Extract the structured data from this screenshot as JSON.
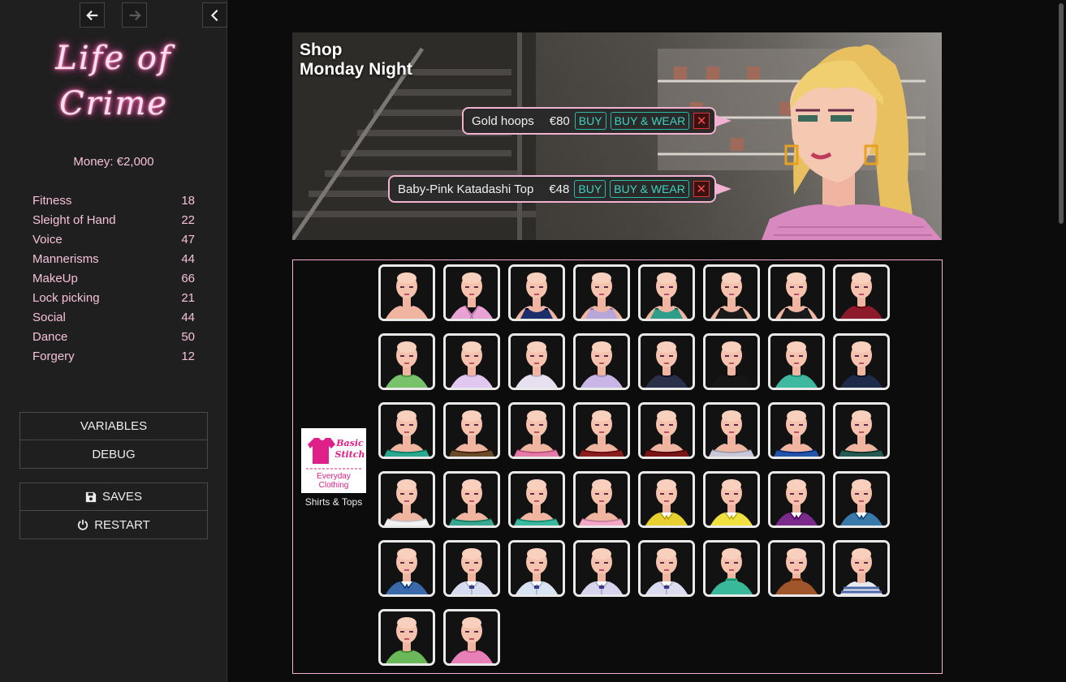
{
  "sidebar": {
    "logo": "Life of Crime",
    "money": "Money: €2,000",
    "skills": [
      {
        "name": "Fitness",
        "value": "18"
      },
      {
        "name": "Sleight of Hand",
        "value": "22"
      },
      {
        "name": "Voice",
        "value": "47"
      },
      {
        "name": "Mannerisms",
        "value": "44"
      },
      {
        "name": "MakeUp",
        "value": "66"
      },
      {
        "name": "Lock picking",
        "value": "21"
      },
      {
        "name": "Social",
        "value": "44"
      },
      {
        "name": "Dance",
        "value": "50"
      },
      {
        "name": "Forgery",
        "value": "12"
      }
    ],
    "variables_label": "VARIABLES",
    "debug_label": "DEBUG",
    "saves_label": "SAVES",
    "restart_label": "RESTART"
  },
  "banner": {
    "title_line1": "Shop",
    "title_line2": "Monday Night",
    "items": [
      {
        "name": "Gold hoops",
        "price": "€80",
        "buy": "BUY",
        "buy_wear": "BUY & WEAR",
        "remove": "✕"
      },
      {
        "name": "Baby-Pink Katadashi Top",
        "price": "€48",
        "buy": "BUY",
        "buy_wear": "BUY & WEAR",
        "remove": "✕"
      }
    ]
  },
  "shop": {
    "logo_line1": "Basic",
    "logo_line2": "Stitch",
    "logo_line3": "Everyday",
    "logo_line4": "Clothing",
    "category": "Shirts & Tops"
  },
  "colors": {
    "accent_pink": "#f0b2d0",
    "teal_button": "#2fb8a5",
    "remove_red": "#dd3333"
  },
  "tops": [
    {
      "color": "#f5d6c3",
      "style": "none"
    },
    {
      "color": "#e9a2d4",
      "style": "wrap"
    },
    {
      "color": "#1d2f6a",
      "style": "tank"
    },
    {
      "color": "#b9a6d8",
      "style": "tank"
    },
    {
      "color": "#2e9e8a",
      "style": "tank"
    },
    {
      "color": "#1a1a1a",
      "style": "tank"
    },
    {
      "color": "#1a1a1a",
      "style": "scoop"
    },
    {
      "color": "#8c1a2b",
      "style": "tee"
    },
    {
      "color": "#79c26c",
      "style": "tee"
    },
    {
      "color": "#e0c8f0",
      "style": "tee"
    },
    {
      "color": "#e6e0f0",
      "style": "tee"
    },
    {
      "color": "#c9b6e6",
      "style": "tee"
    },
    {
      "color": "#2a2f4a",
      "style": "tee"
    },
    {
      "color": "#161616",
      "style": "tee"
    },
    {
      "color": "#3fb8a0",
      "style": "tee"
    },
    {
      "color": "#1e2a4a",
      "style": "tee"
    },
    {
      "color": "#2aa890",
      "style": "offshoulder"
    },
    {
      "color": "#6b4a2a",
      "style": "offshoulder"
    },
    {
      "color": "#e57aa8",
      "style": "offshoulder"
    },
    {
      "color": "#8a1d1d",
      "style": "offshoulder"
    },
    {
      "color": "#7a1616",
      "style": "offshoulder"
    },
    {
      "color": "#c8c8d8",
      "style": "offshoulder"
    },
    {
      "color": "#2255aa",
      "style": "offshoulder"
    },
    {
      "color": "#255a52",
      "style": "offshoulder"
    },
    {
      "color": "#f2f2f2",
      "style": "offshoulder"
    },
    {
      "color": "#3aa890",
      "style": "offshoulder"
    },
    {
      "color": "#3bb8a0",
      "style": "offshoulder"
    },
    {
      "color": "#f4a8c8",
      "style": "offshoulder"
    },
    {
      "color": "#e8d030",
      "style": "collar"
    },
    {
      "color": "#f0e040",
      "style": "collar"
    },
    {
      "color": "#7a2a8a",
      "style": "collar"
    },
    {
      "color": "#3a7aaa",
      "style": "collar"
    },
    {
      "color": "#3a6aaa",
      "style": "collar"
    },
    {
      "color": "#d8dcf0",
      "style": "shirt"
    },
    {
      "color": "#d8e4f4",
      "style": "shirt"
    },
    {
      "color": "#d8d4ee",
      "style": "shirt"
    },
    {
      "color": "#dcdcf0",
      "style": "shirt"
    },
    {
      "color": "#3ab89a",
      "style": "turtle"
    },
    {
      "color": "#a0562a",
      "style": "turtle"
    },
    {
      "color": "#4a6aaa",
      "style": "stripe"
    },
    {
      "color": "#6ab85a",
      "style": "tee"
    },
    {
      "color": "#e880b8",
      "style": "tee"
    }
  ]
}
